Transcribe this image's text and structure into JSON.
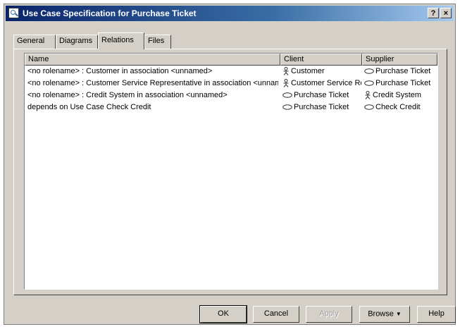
{
  "window": {
    "title": "Use Case Specification for Purchase Ticket",
    "help_glyph": "?",
    "close_glyph": "×"
  },
  "tabs": [
    {
      "label": "General",
      "active": false
    },
    {
      "label": "Diagrams",
      "active": false
    },
    {
      "label": "Relations",
      "active": true
    },
    {
      "label": "Files",
      "active": false
    }
  ],
  "list": {
    "columns": [
      "Name",
      "Client",
      "Supplier"
    ],
    "rows": [
      {
        "name": "<no rolename> : Customer in association <unnamed>",
        "client": "Customer",
        "client_icon": "actor-icon",
        "supplier": "Purchase Ticket",
        "supplier_icon": "usecase-icon"
      },
      {
        "name": "<no rolename> : Customer Service Representative in association <unnamed>",
        "client": "Customer Service Representative",
        "client_icon": "actor-icon",
        "supplier": "Purchase Ticket",
        "supplier_icon": "usecase-icon"
      },
      {
        "name": "<no rolename> : Credit System in association <unnamed>",
        "client": "Purchase Ticket",
        "client_icon": "usecase-icon",
        "supplier": "Credit System",
        "supplier_icon": "actor-icon"
      },
      {
        "name": "depends on Use Case Check Credit",
        "client": "Purchase Ticket",
        "client_icon": "usecase-icon",
        "supplier": "Check Credit",
        "supplier_icon": "usecase-icon"
      }
    ]
  },
  "buttons": {
    "ok": "OK",
    "cancel": "Cancel",
    "apply": "Apply",
    "browse": "Browse",
    "browse_arrow": "▼",
    "help": "Help"
  },
  "colors": {
    "face": "#d4d0c8",
    "title_start": "#0a246a",
    "title_end": "#a6caf0"
  }
}
